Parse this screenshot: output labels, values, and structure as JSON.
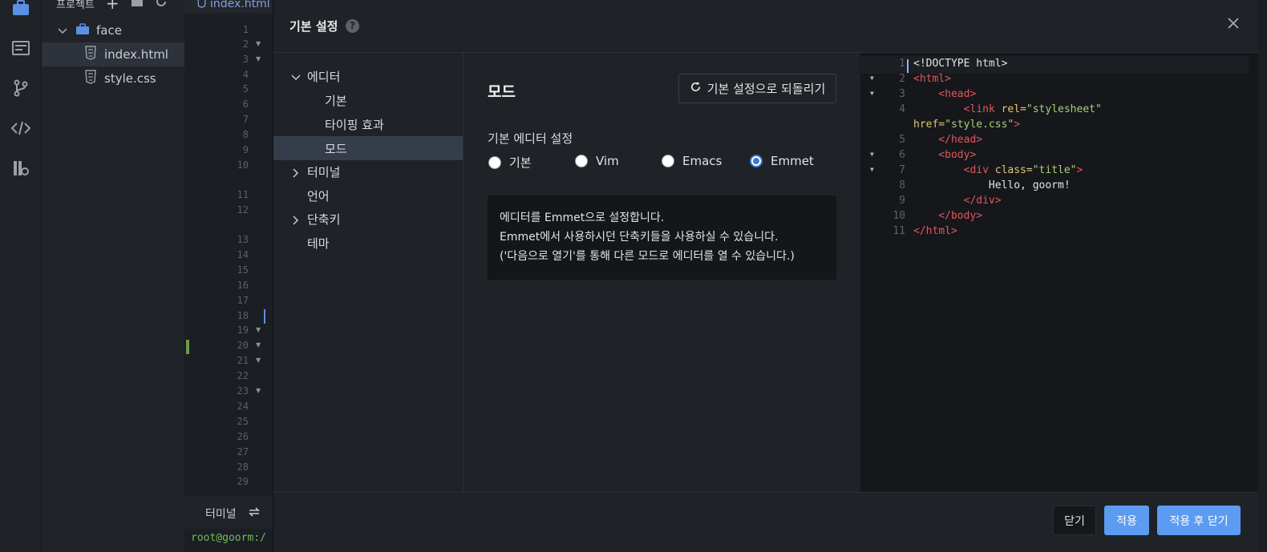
{
  "explorer": {
    "header_label": "프로젝트",
    "folder_name": "face",
    "files": [
      "index.html",
      "style.css"
    ]
  },
  "editor": {
    "tab_label": "index.html",
    "line_numbers": [
      "1",
      "2",
      "3",
      "4",
      "5",
      "6",
      "7",
      "8",
      "9",
      "10",
      "11",
      "12",
      "13",
      "14",
      "15",
      "16",
      "17",
      "18",
      "19",
      "20",
      "21",
      "22",
      "23",
      "24",
      "25",
      "26",
      "27",
      "28",
      "29"
    ],
    "terminal_tab": "터미널",
    "terminal_prompt": "root@goorm:/"
  },
  "modal": {
    "title": "기본 설정",
    "nav": {
      "editor": "에디터",
      "basic": "기본",
      "typing_effect": "타이핑 효과",
      "mode": "모드",
      "terminal": "터미널",
      "language": "언어",
      "shortcuts": "단축키",
      "theme": "테마"
    },
    "section_title": "모드",
    "reset_label": "기본 설정으로 되돌리기",
    "group_label": "기본 에디터 설정",
    "radio_options": [
      "기본",
      "Vim",
      "Emacs",
      "Emmet"
    ],
    "selected_option": "Emmet",
    "description": [
      "에디터를 Emmet으로 설정합니다.",
      "Emmet에서 사용하시던 단축키들을 사용하실 수 있습니다.",
      "('다음으로 열기'를 통해 다른 모드로 에디터를 열 수 있습니다.)"
    ],
    "preview_lines": [
      {
        "n": "1",
        "parts": [
          [
            "t-txt",
            "<!DOCTYPE html>"
          ]
        ]
      },
      {
        "n": "2",
        "parts": [
          [
            "t-tag",
            "<html>"
          ]
        ]
      },
      {
        "n": "3",
        "parts": [
          [
            "t-tag",
            "    <head>"
          ]
        ]
      },
      {
        "n": "4",
        "parts": [
          [
            "t-tag",
            "        <link "
          ],
          [
            "t-attr",
            "rel="
          ],
          [
            "t-str",
            "\"stylesheet\""
          ]
        ]
      },
      {
        "n": "",
        "parts": [
          [
            "t-attr",
            "href="
          ],
          [
            "t-str",
            "\"style.css\""
          ],
          [
            "t-tag",
            ">"
          ]
        ]
      },
      {
        "n": "5",
        "parts": [
          [
            "t-tag",
            "    </head>"
          ]
        ]
      },
      {
        "n": "6",
        "parts": [
          [
            "t-tag",
            "    <body>"
          ]
        ]
      },
      {
        "n": "7",
        "parts": [
          [
            "t-tag",
            "        <div "
          ],
          [
            "t-attr",
            "class="
          ],
          [
            "t-str",
            "\"title\""
          ],
          [
            "t-tag",
            ">"
          ]
        ]
      },
      {
        "n": "8",
        "parts": [
          [
            "t-txt",
            "            Hello, goorm!"
          ]
        ]
      },
      {
        "n": "9",
        "parts": [
          [
            "t-tag",
            "        </div>"
          ]
        ]
      },
      {
        "n": "10",
        "parts": [
          [
            "t-tag",
            "    </body>"
          ]
        ]
      },
      {
        "n": "11",
        "parts": [
          [
            "t-tag",
            "</html>"
          ]
        ]
      }
    ],
    "footer": {
      "close": "닫기",
      "apply": "적용",
      "apply_close": "적용 후 닫기"
    },
    "accent_color": "#5b9cf2"
  }
}
